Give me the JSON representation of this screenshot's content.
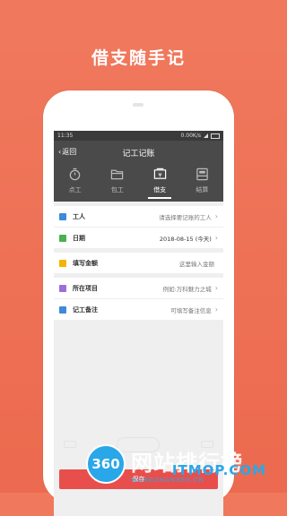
{
  "promo": {
    "title": "借支随手记"
  },
  "status": {
    "time": "11:35",
    "speed": "0.00K/s"
  },
  "nav": {
    "back": "返回",
    "title": "记工记账"
  },
  "tabs": [
    {
      "label": "点工",
      "icon": "clock-icon"
    },
    {
      "label": "包工",
      "icon": "folder-icon"
    },
    {
      "label": "借支",
      "icon": "money-icon",
      "active": true
    },
    {
      "label": "结算",
      "icon": "settle-icon"
    }
  ],
  "form": {
    "worker": {
      "label": "工人",
      "value": "请选择要记账的工人"
    },
    "date": {
      "label": "日期",
      "value": "2018-08-15 (今天)"
    },
    "amount": {
      "label": "填写金额",
      "value": "这里输入金额"
    },
    "project": {
      "label": "所在项目",
      "value": "例如:万科魅力之城"
    },
    "note": {
      "label": "记工备注",
      "value": "可填写备注信息"
    }
  },
  "save": {
    "label": "保存"
  },
  "watermark": {
    "logo": "360",
    "text": "网站排行榜",
    "sub": "WANGZHAN360.CN",
    "brand": "ITMOP.COM"
  },
  "colors": {
    "bg": "#ec6a4f",
    "dark": "#4a4a4a",
    "save": "#e84f4c"
  }
}
